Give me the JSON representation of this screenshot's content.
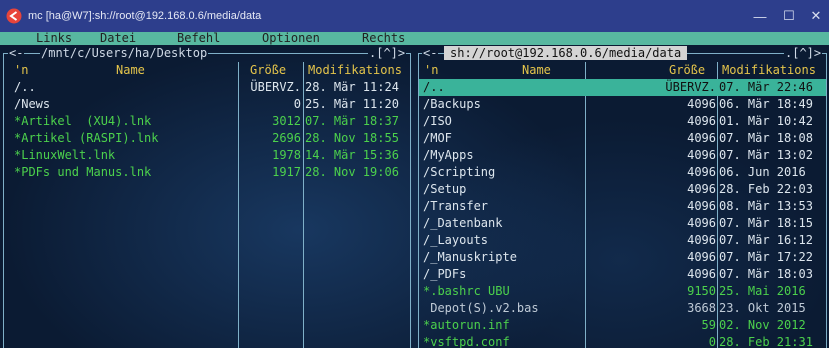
{
  "window": {
    "title": "mc [ha@W7]:sh://root@192.168.0.6/media/data",
    "controls": {
      "minimize": "—",
      "maximize": "☐",
      "close": "✕"
    },
    "icon": "mc-app-icon",
    "accent": "#2d3e8c"
  },
  "menu": {
    "items": [
      "Links",
      "Datei",
      "Befehl",
      "Optionen",
      "Rechts"
    ],
    "color": "#58b8a0"
  },
  "left_panel": {
    "path": "/mnt/c/Users/ha/Desktop",
    "corner_left": "<-",
    "corner_right": ".[^]>",
    "headers": {
      "sort": "'n",
      "name": "Name",
      "size": "Größe",
      "mtime": "Modifikations"
    },
    "files": [
      {
        "name": "/..",
        "size": "ÜBERVZ.",
        "date": "28. Mär 11:24",
        "color": "white"
      },
      {
        "name": "/News",
        "size": "0",
        "date": "25. Mär 11:20",
        "color": "white"
      },
      {
        "name": "*Artikel  (XU4).lnk",
        "size": "3012",
        "date": "07. Mär 18:37",
        "color": "green"
      },
      {
        "name": "*Artikel (RASPI).lnk",
        "size": "2696",
        "date": "28. Nov 18:55",
        "color": "green"
      },
      {
        "name": "*LinuxWelt.lnk",
        "size": "1978",
        "date": "14. Mär 15:36",
        "color": "green"
      },
      {
        "name": "*PDFs und Manus.lnk",
        "size": "1917",
        "date": "28. Nov 19:06",
        "color": "green"
      }
    ]
  },
  "right_panel": {
    "path": "sh://root@192.168.0.6/media/data",
    "corner_left": "<-",
    "corner_right": ".[^]>",
    "headers": {
      "sort": "'n",
      "name": "Name",
      "size": "Größe",
      "mtime": "Modifikations"
    },
    "files": [
      {
        "name": "/..",
        "size": "ÜBERVZ.",
        "date": "07. Mär 22:46",
        "color": "sel"
      },
      {
        "name": "/Backups",
        "size": "4096",
        "date": "06. Mär 18:49",
        "color": "white"
      },
      {
        "name": "/ISO",
        "size": "4096",
        "date": "01. Mär 10:42",
        "color": "white"
      },
      {
        "name": "/MOF",
        "size": "4096",
        "date": "07. Mär 18:08",
        "color": "white"
      },
      {
        "name": "/MyApps",
        "size": "4096",
        "date": "07. Mär 13:02",
        "color": "white"
      },
      {
        "name": "/Scripting",
        "size": "4096",
        "date": "06. Jun 2016",
        "color": "white"
      },
      {
        "name": "/Setup",
        "size": "4096",
        "date": "28. Feb 22:03",
        "color": "white"
      },
      {
        "name": "/Transfer",
        "size": "4096",
        "date": "08. Mär 13:53",
        "color": "white"
      },
      {
        "name": "/_Datenbank",
        "size": "4096",
        "date": "07. Mär 18:15",
        "color": "white"
      },
      {
        "name": "/_Layouts",
        "size": "4096",
        "date": "07. Mär 16:12",
        "color": "white"
      },
      {
        "name": "/_Manuskripte",
        "size": "4096",
        "date": "07. Mär 17:22",
        "color": "white"
      },
      {
        "name": "/_PDFs",
        "size": "4096",
        "date": "07. Mär 18:03",
        "color": "white"
      },
      {
        "name": "*.bashrc UBU",
        "size": "9150",
        "date": "25. Mai 2016",
        "color": "green"
      },
      {
        "name": " Depot(S).v2.bas",
        "size": "3668",
        "date": "23. Okt 2015",
        "color": "dim"
      },
      {
        "name": "*autorun.inf",
        "size": "59",
        "date": "02. Nov 2012",
        "color": "green"
      },
      {
        "name": "*vsftpd.conf",
        "size": "0",
        "date": "28. Feb 21:31",
        "color": "green"
      }
    ]
  }
}
